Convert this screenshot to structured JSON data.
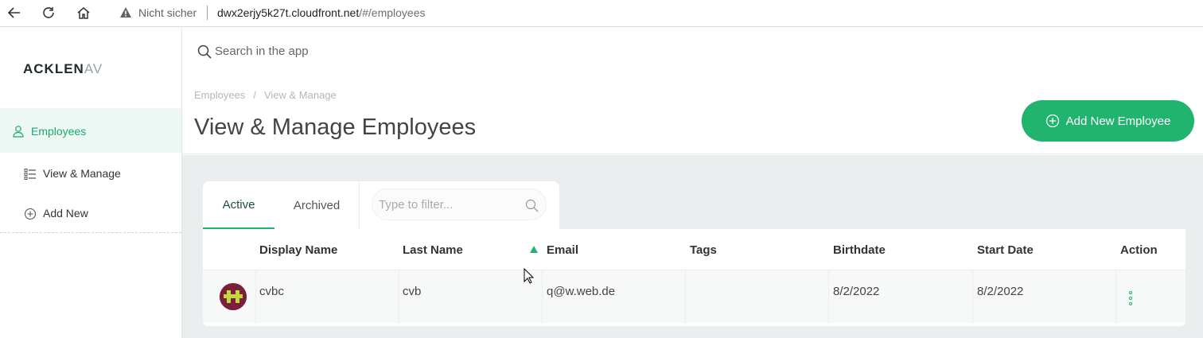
{
  "browser": {
    "insecure_label": "Nicht sicher",
    "url_host": "dwx2erjy5k27t.cloudfront.net",
    "url_path": "/#/employees"
  },
  "sidebar": {
    "logo_text": "ACKLEN",
    "logo_faded": "AV",
    "items": [
      {
        "label": "Employees",
        "icon": "user-icon"
      },
      {
        "label": "View & Manage",
        "icon": "list-icon"
      },
      {
        "label": "Add New",
        "icon": "plus-circle-icon"
      }
    ]
  },
  "search": {
    "placeholder": "Search in the app"
  },
  "header": {
    "breadcrumb": [
      "Employees",
      "View & Manage"
    ],
    "breadcrumb_sep": "/",
    "title": "View & Manage Employees",
    "add_button_label": "Add New Employee"
  },
  "tabs": {
    "active": "Active",
    "archived": "Archived"
  },
  "filter": {
    "placeholder": "Type to filter..."
  },
  "table": {
    "columns": [
      "Display Name",
      "Last Name",
      "Email",
      "Tags",
      "Birthdate",
      "Start Date",
      "Action"
    ],
    "sorted_column": "Email",
    "rows": [
      {
        "display_name": "cvbc",
        "last_name": "cvb",
        "email": "q@w.web.de",
        "tags": "",
        "birthdate": "8/2/2022",
        "start_date": "8/2/2022"
      }
    ]
  },
  "colors": {
    "accent": "#21b46f",
    "sidebar_active_bg": "#eef8f4",
    "content_bg": "#ebeeee"
  }
}
